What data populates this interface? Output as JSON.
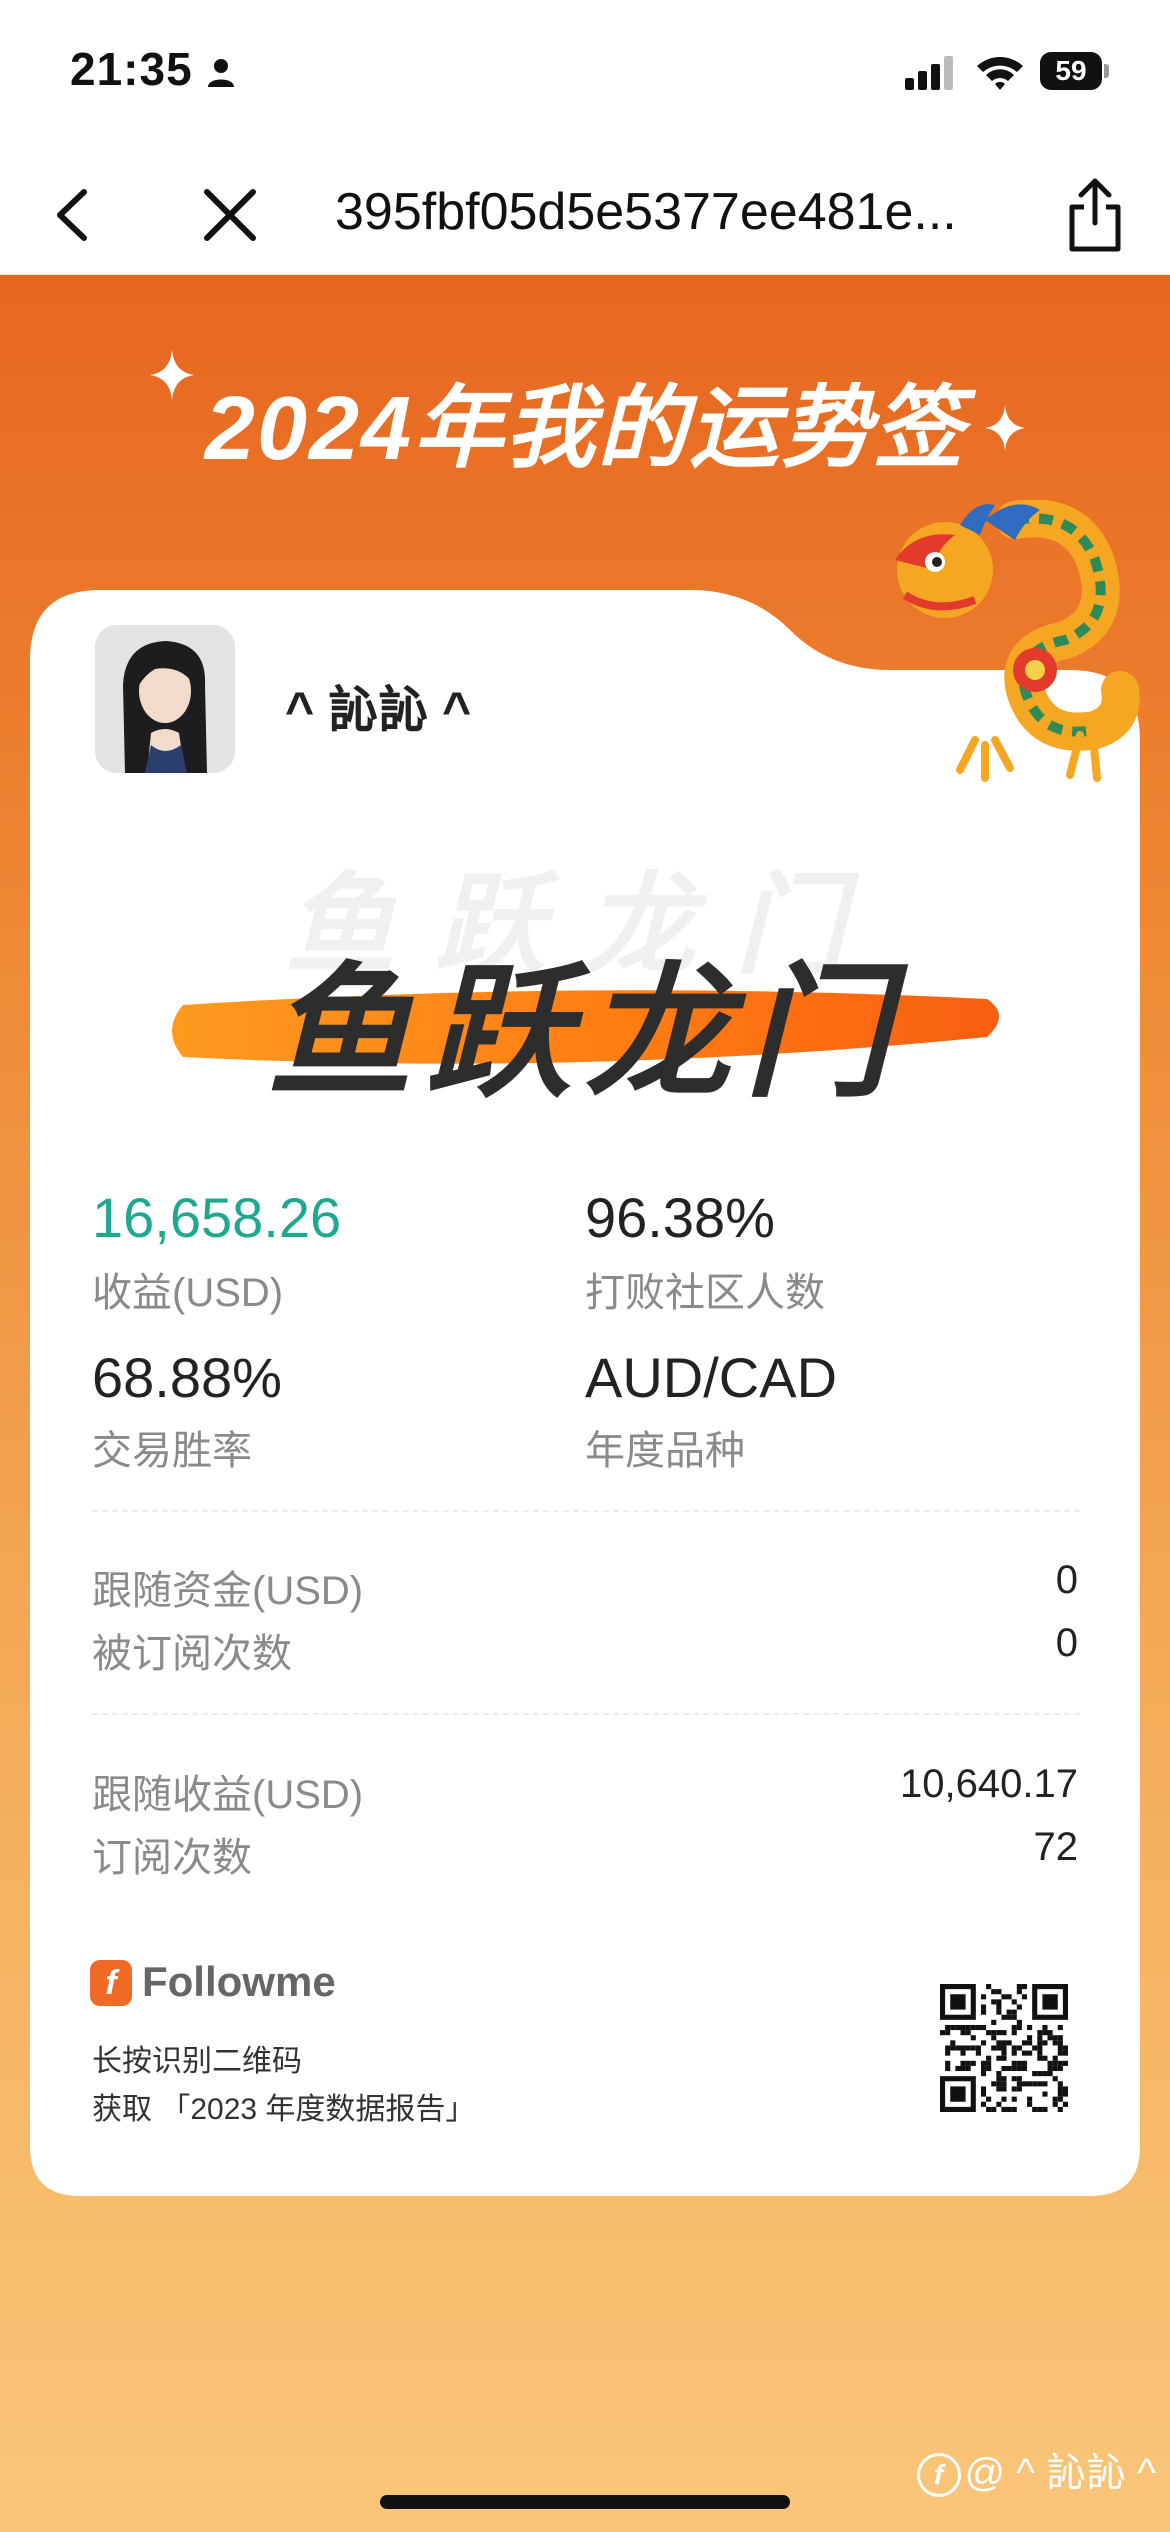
{
  "status_bar": {
    "time": "21:35",
    "battery": "59"
  },
  "nav": {
    "title": "395fbf05d5e5377ee481e..."
  },
  "page": {
    "title": "2024年我的运势签"
  },
  "profile": {
    "username": "^ 訫訫 ^"
  },
  "fortune": {
    "motto": "鱼跃龙门"
  },
  "stats": {
    "profit_value": "16,658.26",
    "profit_label": "收益(USD)",
    "beat_value": "96.38%",
    "beat_label": "打败社区人数",
    "winrate_value": "68.88%",
    "winrate_label": "交易胜率",
    "symbol_value": "AUD/CAD",
    "symbol_label": "年度品种"
  },
  "follow": {
    "funds_label": "跟随资金(USD)",
    "funds_value": "0",
    "subscribed_label": "被订阅次数",
    "subscribed_value": "0"
  },
  "earnings": {
    "profit_label": "跟随收益(USD)",
    "profit_value": "10,640.17",
    "subs_label": "订阅次数",
    "subs_value": "72"
  },
  "footer": {
    "brand": "Followme",
    "line1": "长按识别二维码",
    "line2": "获取 「2023 年度数据报告」"
  },
  "watermark": "@ ^ 訫訫 ^",
  "colors": {
    "accent_green": "#1fa890",
    "brand_orange": "#ee6a25"
  }
}
